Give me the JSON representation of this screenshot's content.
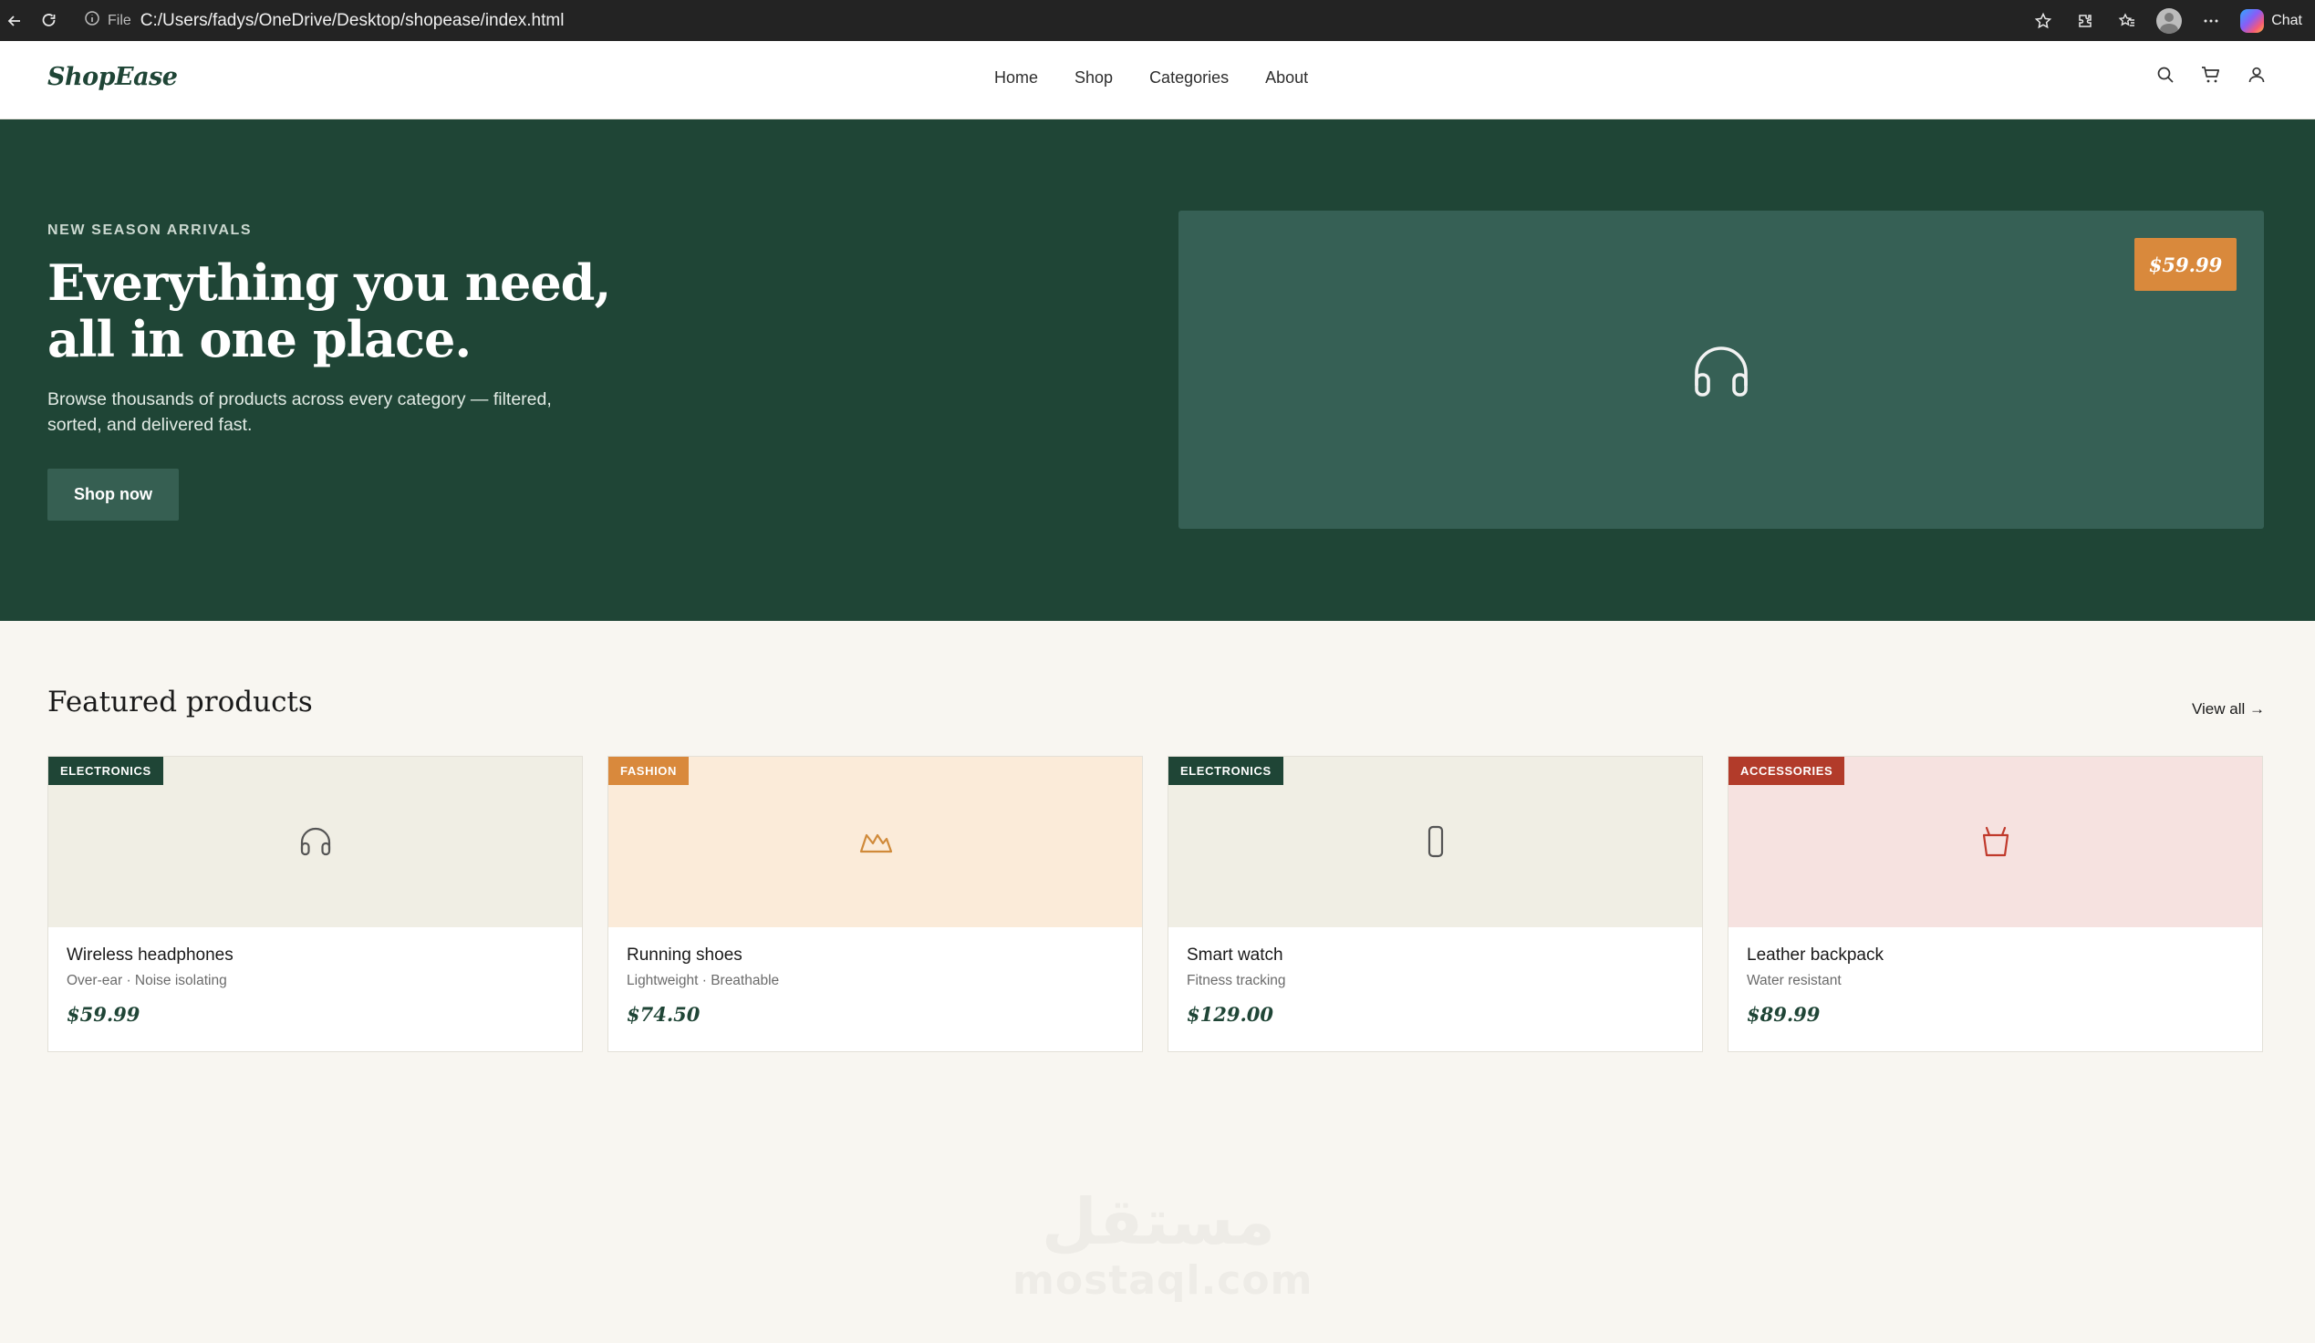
{
  "browser": {
    "file_label": "File",
    "url": "C:/Users/fadys/OneDrive/Desktop/shopease/index.html",
    "chat_label": "Chat"
  },
  "header": {
    "logo": "ShopEase",
    "nav": [
      "Home",
      "Shop",
      "Categories",
      "About"
    ],
    "icons": [
      "search-icon",
      "cart-icon",
      "user-icon"
    ]
  },
  "hero": {
    "eyebrow": "NEW SEASON ARRIVALS",
    "title_line1": "Everything you need,",
    "title_line2": "all in one place.",
    "subtitle": "Browse thousands of products across every category — filtered, sorted, and delivered fast.",
    "cta": "Shop now",
    "price_tag": "$59.99",
    "product_icon": "headphones-icon",
    "bg_color": "#1f4536",
    "panel_color": "#366055",
    "price_color": "#d9893c"
  },
  "featured": {
    "title": "Featured products",
    "view_all": "View all →",
    "products": [
      {
        "badge": "ELECTRONICS",
        "badge_color": "#1f4536",
        "bg": "#f0eee4",
        "icon": "headphones-icon",
        "icon_color": "#555555",
        "name": "Wireless headphones",
        "desc": "Over-ear · Noise isolating",
        "price": "$59.99"
      },
      {
        "badge": "FASHION",
        "badge_color": "#d9893c",
        "bg": "#fbebd9",
        "icon": "shoe-icon",
        "icon_color": "#d08a3a",
        "name": "Running shoes",
        "desc": "Lightweight · Breathable",
        "price": "$74.50"
      },
      {
        "badge": "ELECTRONICS",
        "badge_color": "#1f4536",
        "bg": "#f0eee4",
        "icon": "watch-icon",
        "icon_color": "#555555",
        "name": "Smart watch",
        "desc": "Fitness tracking",
        "price": "$129.00"
      },
      {
        "badge": "ACCESSORIES",
        "badge_color": "#b23b2a",
        "bg": "#f6e2e0",
        "icon": "bag-icon",
        "icon_color": "#c0392b",
        "name": "Leather backpack",
        "desc": "Water resistant",
        "price": "$89.99"
      }
    ]
  },
  "watermark": {
    "arabic": "مستقل",
    "latin": "mostaql.com"
  }
}
